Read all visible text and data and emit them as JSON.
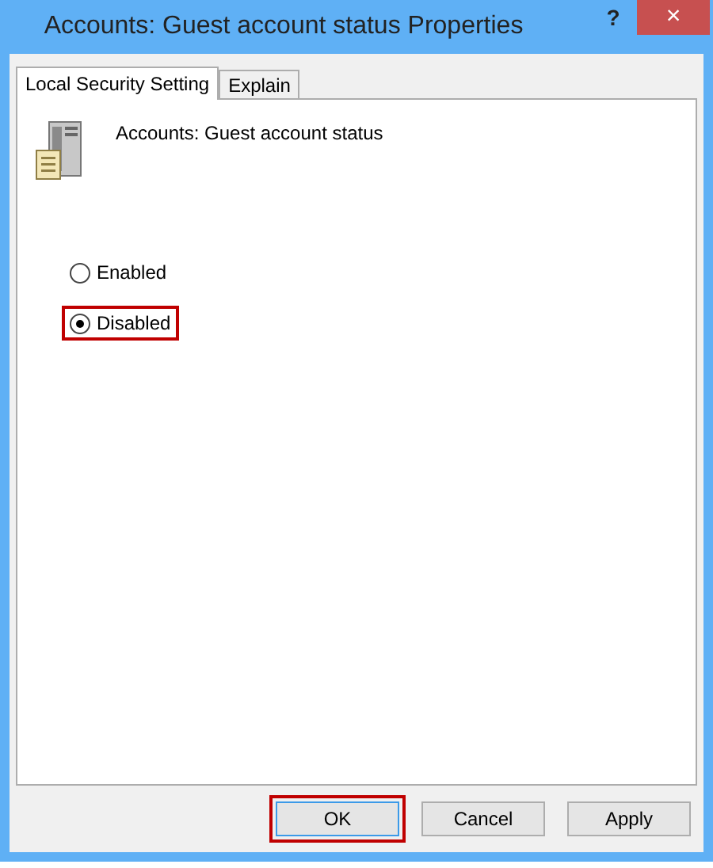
{
  "window": {
    "title": "Accounts: Guest account status Properties",
    "help": "?",
    "close": "×"
  },
  "tabs": [
    {
      "label": "Local Security Setting",
      "selected": true
    },
    {
      "label": "Explain",
      "selected": false
    }
  ],
  "policy": {
    "name": "Accounts: Guest account status"
  },
  "options": [
    {
      "label": "Enabled",
      "selected": false,
      "highlighted": false
    },
    {
      "label": "Disabled",
      "selected": true,
      "highlighted": true
    }
  ],
  "buttons": [
    {
      "label": "OK",
      "default": true,
      "highlighted": true
    },
    {
      "label": "Cancel",
      "default": false,
      "highlighted": false
    },
    {
      "label": "Apply",
      "default": false,
      "highlighted": false
    }
  ]
}
